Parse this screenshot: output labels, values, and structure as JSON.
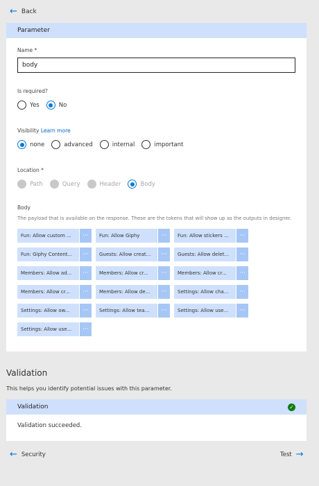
{
  "nav": {
    "back_label": "Back",
    "prev_label": "Security",
    "next_label": "Test"
  },
  "parameter": {
    "header": "Parameter",
    "name_label": "Name *",
    "name_value": "body",
    "required_label": "Is required?",
    "required_options": [
      "Yes",
      "No"
    ],
    "required_selected": "No",
    "visibility_label": "Visibility",
    "visibility_link": "Learn more",
    "visibility_options": [
      "none",
      "advanced",
      "internal",
      "important"
    ],
    "visibility_selected": "none",
    "location_label": "Location *",
    "location_options": [
      "Path",
      "Query",
      "Header",
      "Body"
    ],
    "location_selected": "Body",
    "body_label": "Body",
    "body_hint": "The payload that is available on the response. These are the tokens that will show up as the outputs in designer.",
    "tokens": [
      [
        "Fun: Allow custom ...",
        "Fun: Allow Giphy",
        "Fun: Allow stickers ..."
      ],
      [
        "Fun: Giphy Content...",
        "Guests: Allow creat...",
        "Guests: Allow delet..."
      ],
      [
        "Members: Allow ad...",
        "Members: Allow cr...",
        "Members: Allow cr..."
      ],
      [
        "Members: Allow cr...",
        "Members: Allow de...",
        "Settings: Allow cha..."
      ],
      [
        "Settings: Allow ow...",
        "Settings: Allow tea...",
        "Settings: Allow use..."
      ],
      [
        "Settings: Allow use..."
      ]
    ],
    "token_more": "···"
  },
  "validation": {
    "title": "Validation",
    "description": "This helps you identify potential issues with this parameter.",
    "header": "Validation",
    "status_icon": "check-circle-icon",
    "status_color": "#107c10",
    "message": "Validation succeeded."
  },
  "colors": {
    "accent": "#0078d4",
    "header_bg": "#cfe0fc",
    "chip_bg": "#cfe0fc",
    "chip_more_bg": "#a6c7f6"
  }
}
